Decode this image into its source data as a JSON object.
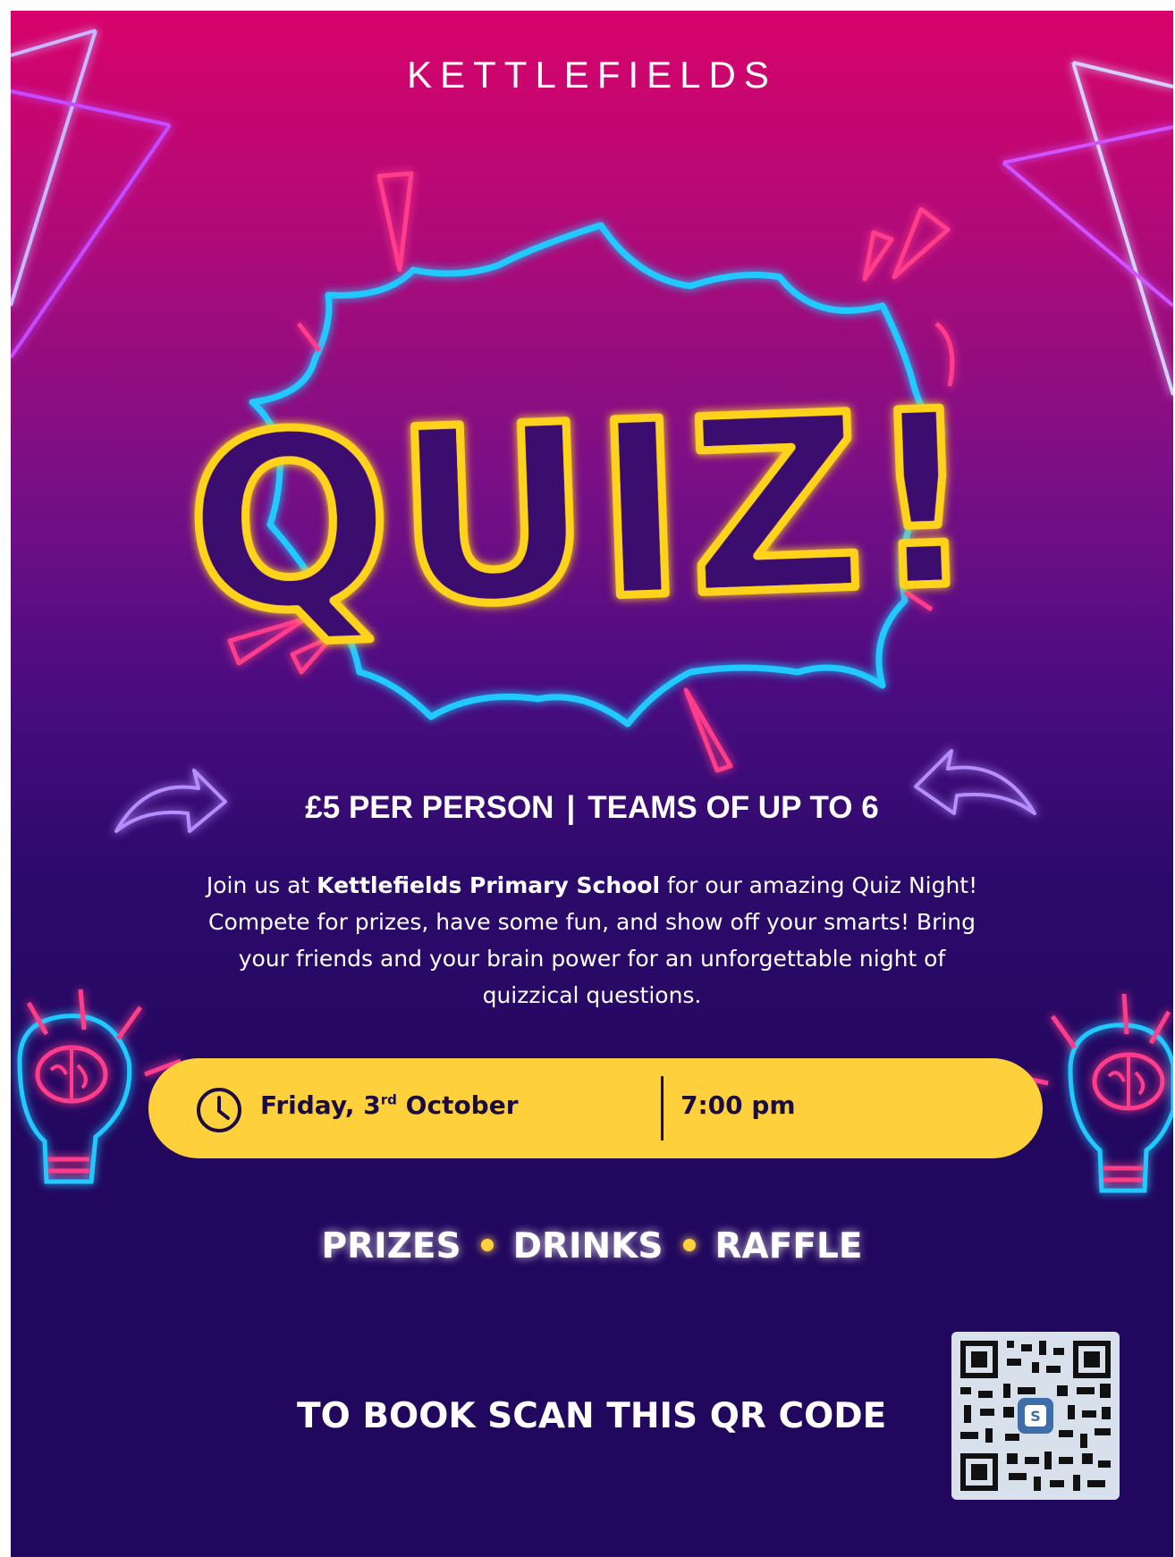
{
  "brand": "KETTLEFIELDS",
  "headline": "QUIZ!",
  "price_line": {
    "price": "£5 PER PERSON",
    "separator": "|",
    "teams": "TEAMS OF UP TO 6"
  },
  "intro": {
    "part1": "Join us at ",
    "school": "Kettlefields Primary School",
    "part2": " for our amazing Quiz Night!  Compete for prizes, have some fun, and show off your smarts!  Bring your friends and your brain power for an unforgettable night of quizzical questions."
  },
  "event": {
    "day": "Friday, 3",
    "day_suffix": "rd",
    "month": " October",
    "time": "7:00 pm"
  },
  "extras": [
    "PRIZES",
    "DRINKS",
    "RAFFLE"
  ],
  "booking": {
    "text": "TO BOOK SCAN THIS QR CODE"
  },
  "colors": {
    "top": "#d8036a",
    "bottom": "#22075e",
    "accent_yellow": "#fed13c",
    "neon_blue": "#22c9ff",
    "neon_pink": "#ff3d8a",
    "neon_yellow": "#ffd21f"
  },
  "icons": [
    "clock-icon",
    "brain-bulb-icon",
    "curved-arrow-icon",
    "qr-code"
  ]
}
